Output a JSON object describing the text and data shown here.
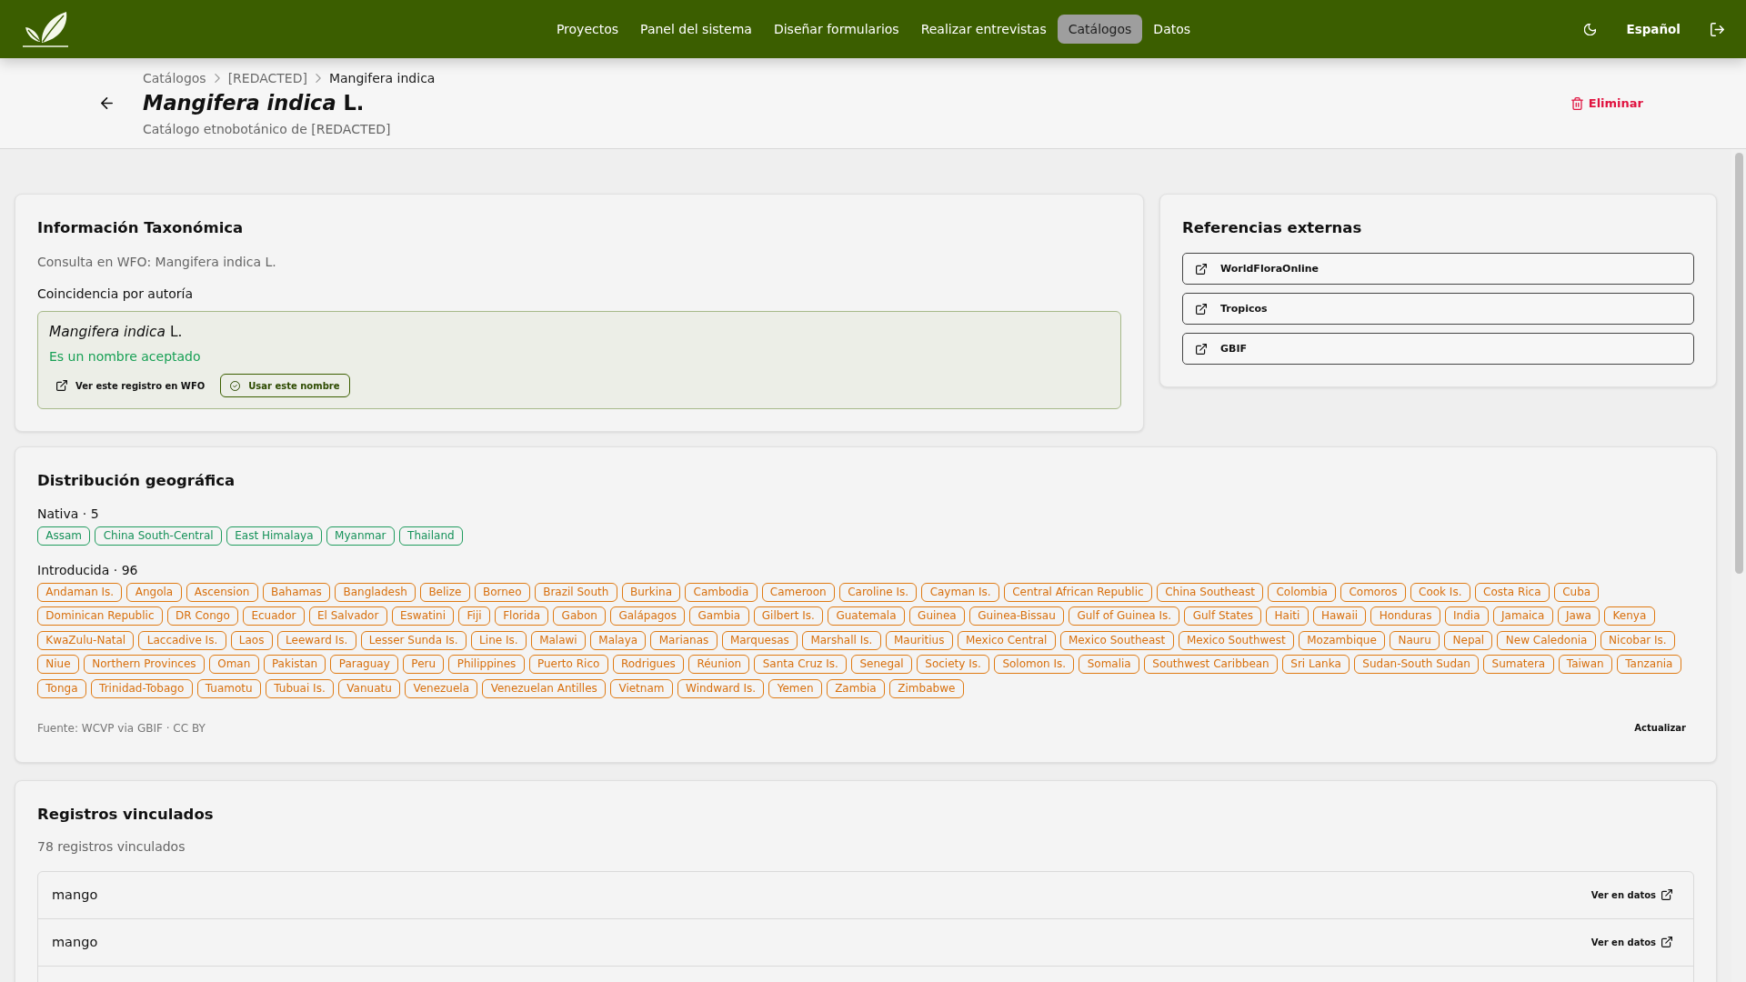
{
  "navbar": {
    "nav_items": [
      {
        "label": "Proyectos",
        "selected": false
      },
      {
        "label": "Panel del sistema",
        "selected": false
      },
      {
        "label": "Diseñar formularios",
        "selected": false
      },
      {
        "label": "Realizar entrevistas",
        "selected": false
      },
      {
        "label": "Catálogos",
        "selected": true
      },
      {
        "label": "Datos",
        "selected": false
      }
    ],
    "language": "Español"
  },
  "header": {
    "breadcrumb": [
      {
        "label": "Catálogos",
        "current": false
      },
      {
        "label": "[REDACTED]",
        "current": false
      },
      {
        "label": "Mangifera indica",
        "current": true
      }
    ],
    "title": "*Mangifera indica* L.",
    "subtitle": "Catálogo etnobotánico de [REDACTED]",
    "delete_button": "Eliminar"
  },
  "taxonomic_info": {
    "title": "Información Taxonómica",
    "query": "Consulta en WFO: Mangifera indica L.",
    "match_label": "Coincidencia por autoría",
    "match": {
      "name": "*Mangifera indica* L.",
      "status": "Es un nombre aceptado",
      "view_link": "Ver este registro en WFO",
      "use_button": "Usar este nombre"
    }
  },
  "external_references": {
    "title": "Referencias externas",
    "links": [
      "WorldFloraOnline",
      "Tropicos",
      "GBIF"
    ]
  },
  "distribution": {
    "title": "Distribución geográfica",
    "groups": [
      {
        "kind": "native",
        "label": "Nativa · 5",
        "regions": [
          "Assam",
          "China South-Central",
          "East Himalaya",
          "Myanmar",
          "Thailand"
        ]
      },
      {
        "kind": "introduced",
        "label": "Introducida · 96",
        "regions": [
          "Andaman Is.",
          "Angola",
          "Ascension",
          "Bahamas",
          "Bangladesh",
          "Belize",
          "Borneo",
          "Brazil South",
          "Burkina",
          "Cambodia",
          "Cameroon",
          "Caroline Is.",
          "Cayman Is.",
          "Central African Republic",
          "China Southeast",
          "Colombia",
          "Comoros",
          "Cook Is.",
          "Costa Rica",
          "Cuba",
          "Dominican Republic",
          "DR Congo",
          "Ecuador",
          "El Salvador",
          "Eswatini",
          "Fiji",
          "Florida",
          "Gabon",
          "Galápagos",
          "Gambia",
          "Gilbert Is.",
          "Guatemala",
          "Guinea",
          "Guinea-Bissau",
          "Gulf of Guinea Is.",
          "Gulf States",
          "Haiti",
          "Hawaii",
          "Honduras",
          "India",
          "Jamaica",
          "Jawa",
          "Kenya",
          "KwaZulu-Natal",
          "Laccadive Is.",
          "Laos",
          "Leeward Is.",
          "Lesser Sunda Is.",
          "Line Is.",
          "Malawi",
          "Malaya",
          "Marianas",
          "Marquesas",
          "Marshall Is.",
          "Mauritius",
          "Mexico Central",
          "Mexico Southeast",
          "Mexico Southwest",
          "Mozambique",
          "Nauru",
          "Nepal",
          "New Caledonia",
          "Nicobar Is.",
          "Niue",
          "Northern Provinces",
          "Oman",
          "Pakistan",
          "Paraguay",
          "Peru",
          "Philippines",
          "Puerto Rico",
          "Rodrigues",
          "Réunion",
          "Santa Cruz Is.",
          "Senegal",
          "Society Is.",
          "Solomon Is.",
          "Somalia",
          "Southwest Caribbean",
          "Sri Lanka",
          "Sudan-South Sudan",
          "Sumatera",
          "Taiwan",
          "Tanzania",
          "Tonga",
          "Trinidad-Tobago",
          "Tuamotu",
          "Tubuai Is.",
          "Vanuatu",
          "Venezuela",
          "Venezuelan Antilles",
          "Vietnam",
          "Windward Is.",
          "Yemen",
          "Zambia",
          "Zimbabwe"
        ]
      }
    ],
    "source": "Fuente: WCVP via GBIF · CC BY",
    "refresh_button": "Actualizar"
  },
  "linked_records": {
    "title": "Registros vinculados",
    "count": "78 registros vinculados",
    "records": [
      {
        "name": "mango",
        "link": "Ver en datos"
      },
      {
        "name": "mango",
        "link": "Ver en datos"
      }
    ]
  }
}
